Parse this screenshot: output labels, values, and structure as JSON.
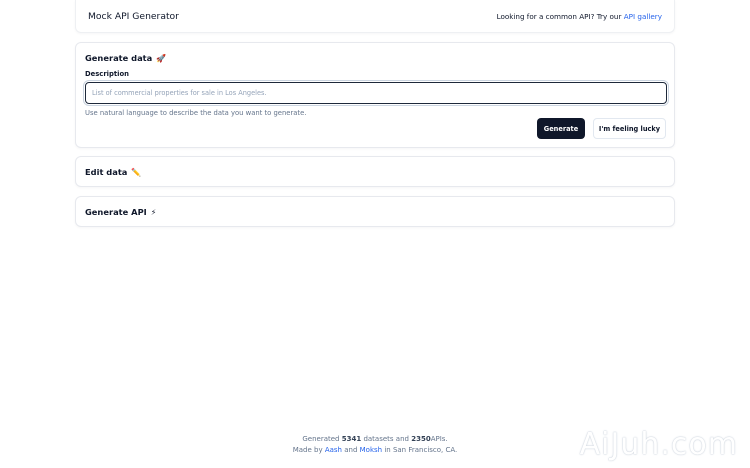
{
  "header": {
    "app_title": "Mock API Generator",
    "prompt_text": "Looking for a common API? Try our",
    "gallery_link": "API gallery"
  },
  "generate_card": {
    "title": "Generate data",
    "title_emoji": "🚀",
    "description_label": "Description",
    "description_value": "",
    "description_placeholder": "List of commercial properties for sale in Los Angeles.",
    "helper_text": "Use natural language to describe the data you want to generate.",
    "generate_button": "Generate",
    "lucky_button": "I'm feeling lucky"
  },
  "edit_card": {
    "title": "Edit data",
    "title_emoji": "✏️"
  },
  "api_card": {
    "title": "Generate API",
    "title_emoji": "⚡"
  },
  "footer": {
    "line1_prefix": "Generated",
    "datasets_count": "5341",
    "line1_mid": "datasets and",
    "apis_count": "2350",
    "line1_suffix": "APIs.",
    "line2_prefix": "Made by",
    "author1": "Aash",
    "line2_and": "and",
    "author2": "Moksh",
    "line2_suffix": "in San Francisco, CA."
  },
  "watermark": "AiJuh.com",
  "colors": {
    "accent_link": "#2563eb",
    "primary_button": "#0f172a"
  }
}
